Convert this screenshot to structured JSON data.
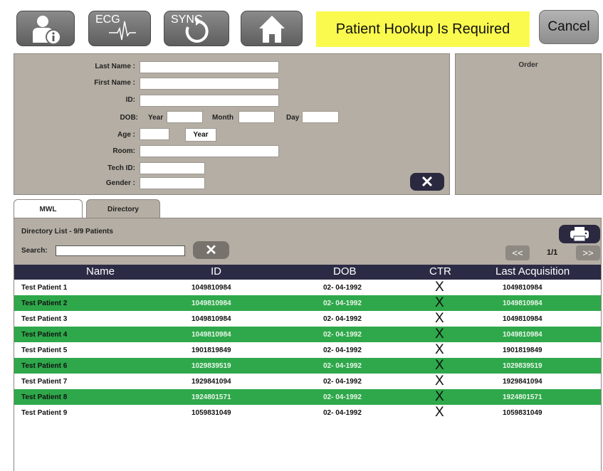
{
  "toolbar": {
    "ecg_label": "ECG",
    "sync_label": "SYNC",
    "banner": "Patient Hookup Is Required",
    "cancel_label": "Cancel"
  },
  "form": {
    "last_name_label": "Last Name :",
    "first_name_label": "First Name :",
    "id_label": "ID:",
    "dob_label": "DOB:",
    "year_label": "Year",
    "month_label": "Month",
    "day_label": "Day",
    "age_label": "Age :",
    "age_unit": "Year",
    "room_label": "Room:",
    "tech_id_label": "Tech ID:",
    "gender_label": "Gender :",
    "clear_icon": "✕"
  },
  "order": {
    "title": "Order"
  },
  "tabs": [
    {
      "label": "MWL"
    },
    {
      "label": "Directory"
    }
  ],
  "directory": {
    "count_text": "Directory List - 9/9 Patients",
    "search_label": "Search:",
    "search_value": "",
    "clear_icon": "✕",
    "prev_label": "<<",
    "page": "1/1",
    "next_label": ">>"
  },
  "table": {
    "columns": [
      "Name",
      "ID",
      "DOB",
      "CTR",
      "Last Acquisition"
    ],
    "rows": [
      {
        "name": "Test Patient 1",
        "id": "1049810984",
        "dob": "02- 04-1992",
        "ctr": "X",
        "last": "1049810984"
      },
      {
        "name": "Test Patient 2",
        "id": "1049810984",
        "dob": "02- 04-1992",
        "ctr": "X",
        "last": "1049810984"
      },
      {
        "name": "Test Patient 3",
        "id": "1049810984",
        "dob": "02- 04-1992",
        "ctr": "X",
        "last": "1049810984"
      },
      {
        "name": "Test Patient 4",
        "id": "1049810984",
        "dob": "02- 04-1992",
        "ctr": "X",
        "last": "1049810984"
      },
      {
        "name": "Test Patient 5",
        "id": "1901819849",
        "dob": "02- 04-1992",
        "ctr": "X",
        "last": "1901819849"
      },
      {
        "name": "Test Patient 6",
        "id": "1029839519",
        "dob": "02- 04-1992",
        "ctr": "X",
        "last": "1029839519"
      },
      {
        "name": "Test Patient 7",
        "id": "1929841094",
        "dob": "02- 04-1992",
        "ctr": "X",
        "last": "1929841094"
      },
      {
        "name": "Test Patient 8",
        "id": "1924801571",
        "dob": "02- 04-1992",
        "ctr": "X",
        "last": "1924801571"
      },
      {
        "name": "Test Patient 9",
        "id": "1059831049",
        "dob": "02- 04-1992",
        "ctr": "X",
        "last": "1059831049"
      }
    ]
  },
  "colors": {
    "toolbar_button": "#6f6f6f",
    "banner": "#fafa4e",
    "panel": "#b5aea4",
    "table_header": "#2c2b45",
    "row_highlight": "#2ea84a",
    "dark_button": "#2a2940"
  },
  "icons": {
    "info": "patient-info-icon",
    "ecg": "ecg-waveform-icon",
    "sync": "sync-arrows-icon",
    "home": "home-icon",
    "print": "printer-icon"
  }
}
